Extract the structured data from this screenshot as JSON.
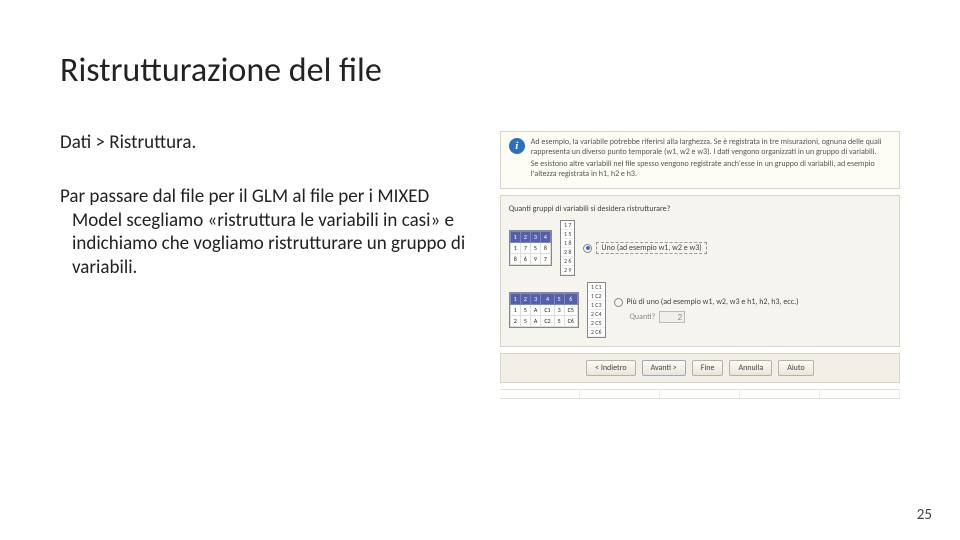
{
  "title": "Ristrutturazione del file",
  "path": "Dati > Ristruttura.",
  "body": "Par passare dal file per il GLM al file per i MIXED Model scegliamo «ristruttura le variabili in casi» e indichiamo che vogliamo ristrutturare un gruppo di variabili.",
  "info": {
    "l1": "Ad esempio, la variabile potrebbe riferirsi alla larghezza. Se è registrata in tre misurazioni, ognuna delle quali rappresenta un diverso punto temporale (w1, w2 e w3). I dati vengono organizzati in un gruppo di variabili.",
    "l2": "Se esistono altre variabili nel file spesso vengono registrate anch'esse in un gruppo di variabili, ad esempio l'altezza registrata in h1, h2 e h3."
  },
  "dialog": {
    "prompt": "Quanti gruppi di variabili si desidera ristrutturare?",
    "opt1": "Uno (ad esempio w1, w2 e w3)",
    "opt2": "Più di uno (ad esempio w1, w2, w3 e h1, h2, h3, ecc.)",
    "countLabel": "Quanti?",
    "countValue": "2"
  },
  "thumb1": {
    "head": [
      "1",
      "2",
      "3",
      "4"
    ],
    "r1": [
      "1",
      "7",
      "5",
      "8"
    ],
    "r2": [
      "8",
      "6",
      "9",
      "7"
    ]
  },
  "thumb1_list": [
    "1 7",
    "1 5",
    "1 8",
    "2 8",
    "2 6",
    "2 9"
  ],
  "thumb2": {
    "head": [
      "1",
      "2",
      "3",
      "4",
      "5",
      "6"
    ],
    "r1": [
      "1",
      "5",
      "A",
      "C1",
      "3",
      "C5"
    ],
    "r2": [
      "2",
      "5",
      "A",
      "C2",
      "5",
      "C6"
    ]
  },
  "thumb2_list": [
    "1 C1",
    "1 C2",
    "1 C3",
    "2 C4",
    "2 C5",
    "2 C6"
  ],
  "buttons": {
    "back": "< Indietro",
    "next": "Avanti >",
    "finish": "Fine",
    "cancel": "Annulla",
    "help": "Aiuto"
  },
  "page": "25"
}
